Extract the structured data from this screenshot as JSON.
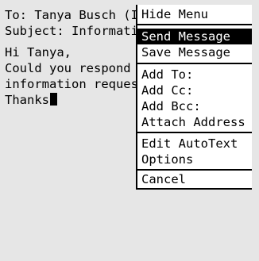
{
  "message": {
    "to_line": "To: Tanya Busch (I",
    "subject_line": "Subject: Informati",
    "body_lines": [
      "Hi Tanya,",
      "Could you respond",
      "information reques",
      "Thanks"
    ]
  },
  "menu": {
    "hide_menu": "Hide Menu",
    "send_message": "Send Message",
    "save_message": "Save Message",
    "add_to": "Add To:",
    "add_cc": "Add Cc:",
    "add_bcc": "Add Bcc:",
    "attach_address": "Attach Address",
    "edit_autotext": "Edit AutoText",
    "options": "Options",
    "cancel": "Cancel",
    "selected_item": "Send Message"
  }
}
